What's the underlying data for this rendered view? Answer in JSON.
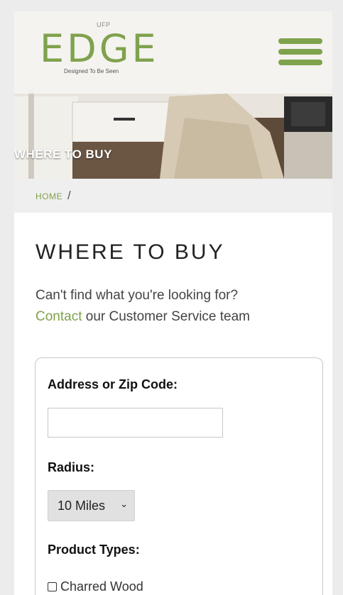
{
  "header": {
    "logo_top": "UFP",
    "logo_main": "EDGE",
    "logo_tagline": "Designed To Be Seen",
    "menu_icon": "hamburger-menu-icon"
  },
  "hero": {
    "title": "WHERE TO BUY"
  },
  "breadcrumb": {
    "home": "HOME",
    "separator": "/"
  },
  "page": {
    "title": "WHERE TO BUY",
    "intro_text": "Can't find what you're looking for?",
    "contact_link": "Contact",
    "intro_suffix": "our Customer Service team"
  },
  "form": {
    "address_label": "Address or Zip Code:",
    "address_value": "",
    "radius_label": "Radius:",
    "radius_selected": "10 Miles",
    "product_types_label": "Product Types:",
    "product_types": [
      {
        "label": "Charred Wood",
        "checked": false
      }
    ]
  },
  "colors": {
    "accent": "#7fa24c",
    "text": "#444444",
    "breadcrumb_bg": "#efefef"
  }
}
